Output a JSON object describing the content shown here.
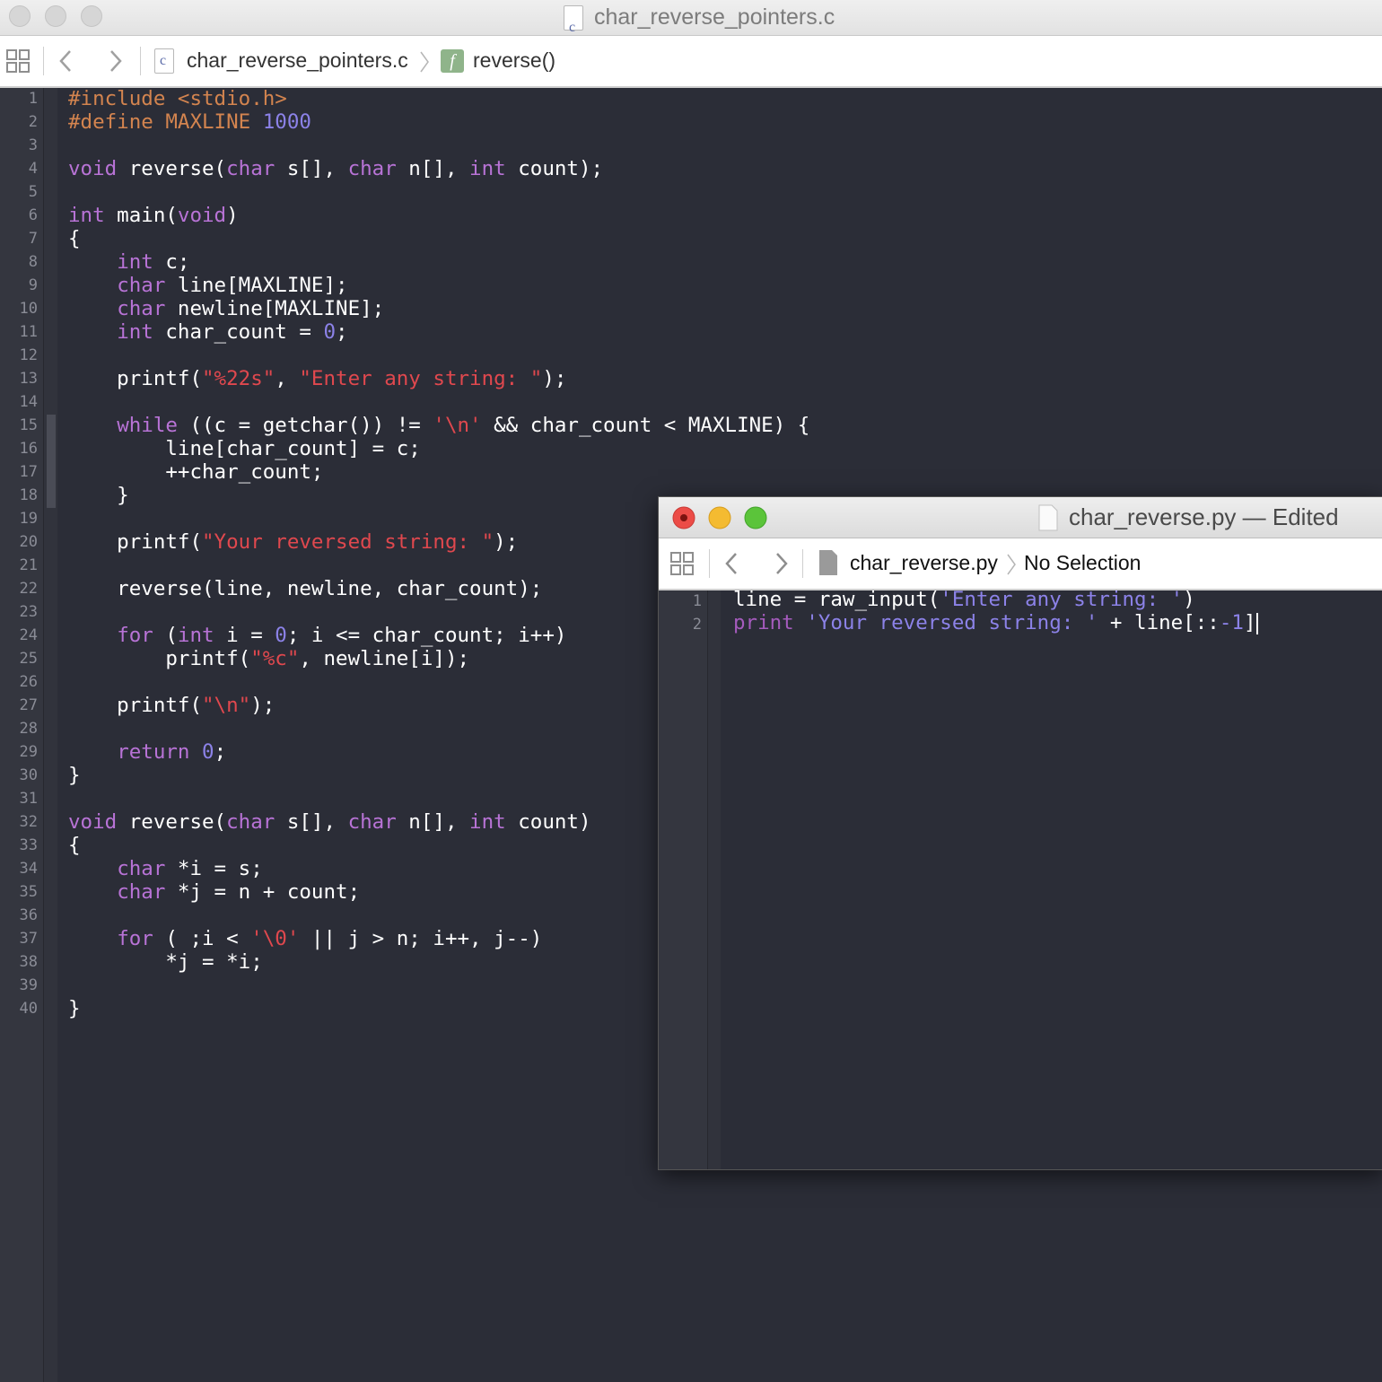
{
  "main_window": {
    "title": "char_reverse_pointers.c",
    "file_icon_letter": "c",
    "breadcrumb_file": "char_reverse_pointers.c",
    "breadcrumb_function": "reverse()",
    "function_icon_letter": "f"
  },
  "main_code": {
    "line_count": 40
  },
  "python_window": {
    "title": "char_reverse.py — Edited",
    "breadcrumb_file": "char_reverse.py",
    "breadcrumb_selection": "No Selection"
  },
  "python_code": {
    "line_count": 2
  },
  "colors": {
    "keyword": "#b873d6",
    "string": "#e0484e",
    "number": "#8c82e8",
    "preprocessor": "#d3844f",
    "editor_bg": "#2b2d37"
  },
  "icons": {
    "grid": "grid-icon",
    "back": "chevron-left-icon",
    "forward": "chevron-right-icon",
    "file": "file-icon",
    "function": "function-icon"
  }
}
